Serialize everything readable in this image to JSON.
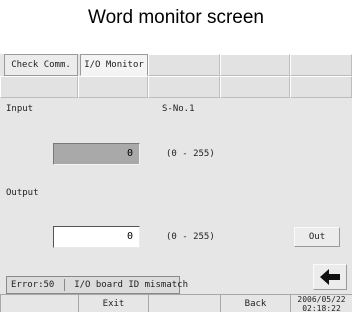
{
  "title": "Word monitor screen",
  "tabs": [
    {
      "label": "Check Comm."
    },
    {
      "label": "I/O Monitor"
    }
  ],
  "input": {
    "label": "Input",
    "value": "0",
    "range": "(0 - 255)"
  },
  "s_no": "S-No.1",
  "output": {
    "label": "Output",
    "value": "0",
    "range": "(0 - 255)",
    "button_label": "Out"
  },
  "status": {
    "code": "Error:50",
    "message": "I/O board ID mismatch"
  },
  "footer": {
    "exit_label": "Exit",
    "back_label": "Back",
    "date": "2006/05/22",
    "time": "02:18:22"
  },
  "icons": {
    "back_arrow": "arrow-left-icon"
  }
}
